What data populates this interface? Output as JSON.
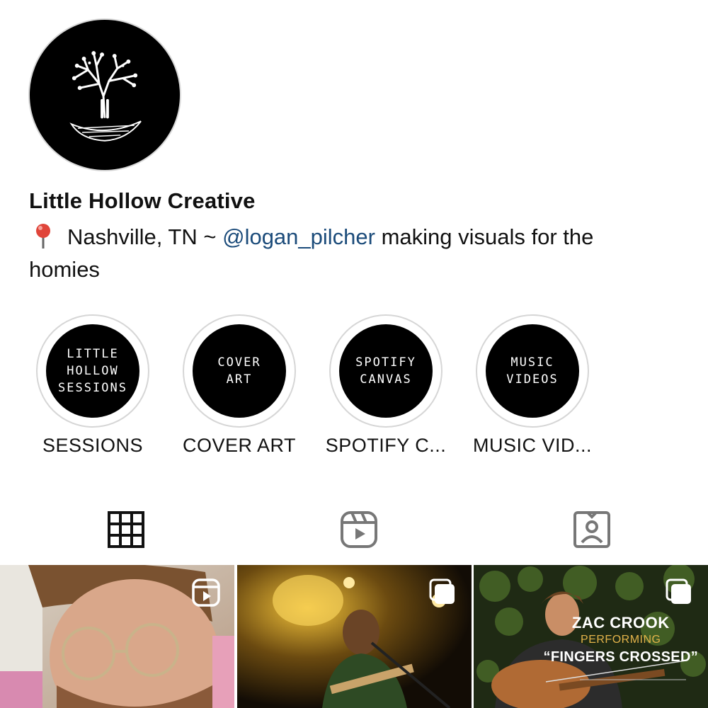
{
  "profile": {
    "name": "Little Hollow Creative",
    "bio": {
      "location": "Nashville, TN ~ ",
      "mention": "@logan_pilcher",
      "rest": " making visuals for the homies"
    }
  },
  "highlights": [
    {
      "cover_lines": [
        "LITTLE",
        "HOLLOW",
        "SESSIONS"
      ],
      "label": "SESSIONS"
    },
    {
      "cover_lines": [
        "COVER",
        "ART"
      ],
      "label": "COVER ART"
    },
    {
      "cover_lines": [
        "SPOTIFY",
        "CANVAS"
      ],
      "label": "SPOTIFY C..."
    },
    {
      "cover_lines": [
        "MUSIC",
        "VIDEOS"
      ],
      "label": "MUSIC VID..."
    }
  ],
  "tabs": [
    {
      "icon": "grid-icon",
      "selected": true
    },
    {
      "icon": "reels-icon",
      "selected": false
    },
    {
      "icon": "tagged-icon",
      "selected": false
    }
  ],
  "posts": [
    {
      "type": "reel",
      "badge_icon": "reels-icon"
    },
    {
      "type": "carousel",
      "badge_icon": "carousel-icon"
    },
    {
      "type": "carousel",
      "badge_icon": "carousel-icon",
      "overlay": {
        "line1": "ZAC CROOK",
        "line2": "PERFORMING",
        "line3": "“FINGERS CROSSED”"
      }
    }
  ],
  "colors": {
    "mention": "#1b4b7a",
    "accent_gold": "#e3b34a",
    "icon_gray": "#777777"
  }
}
